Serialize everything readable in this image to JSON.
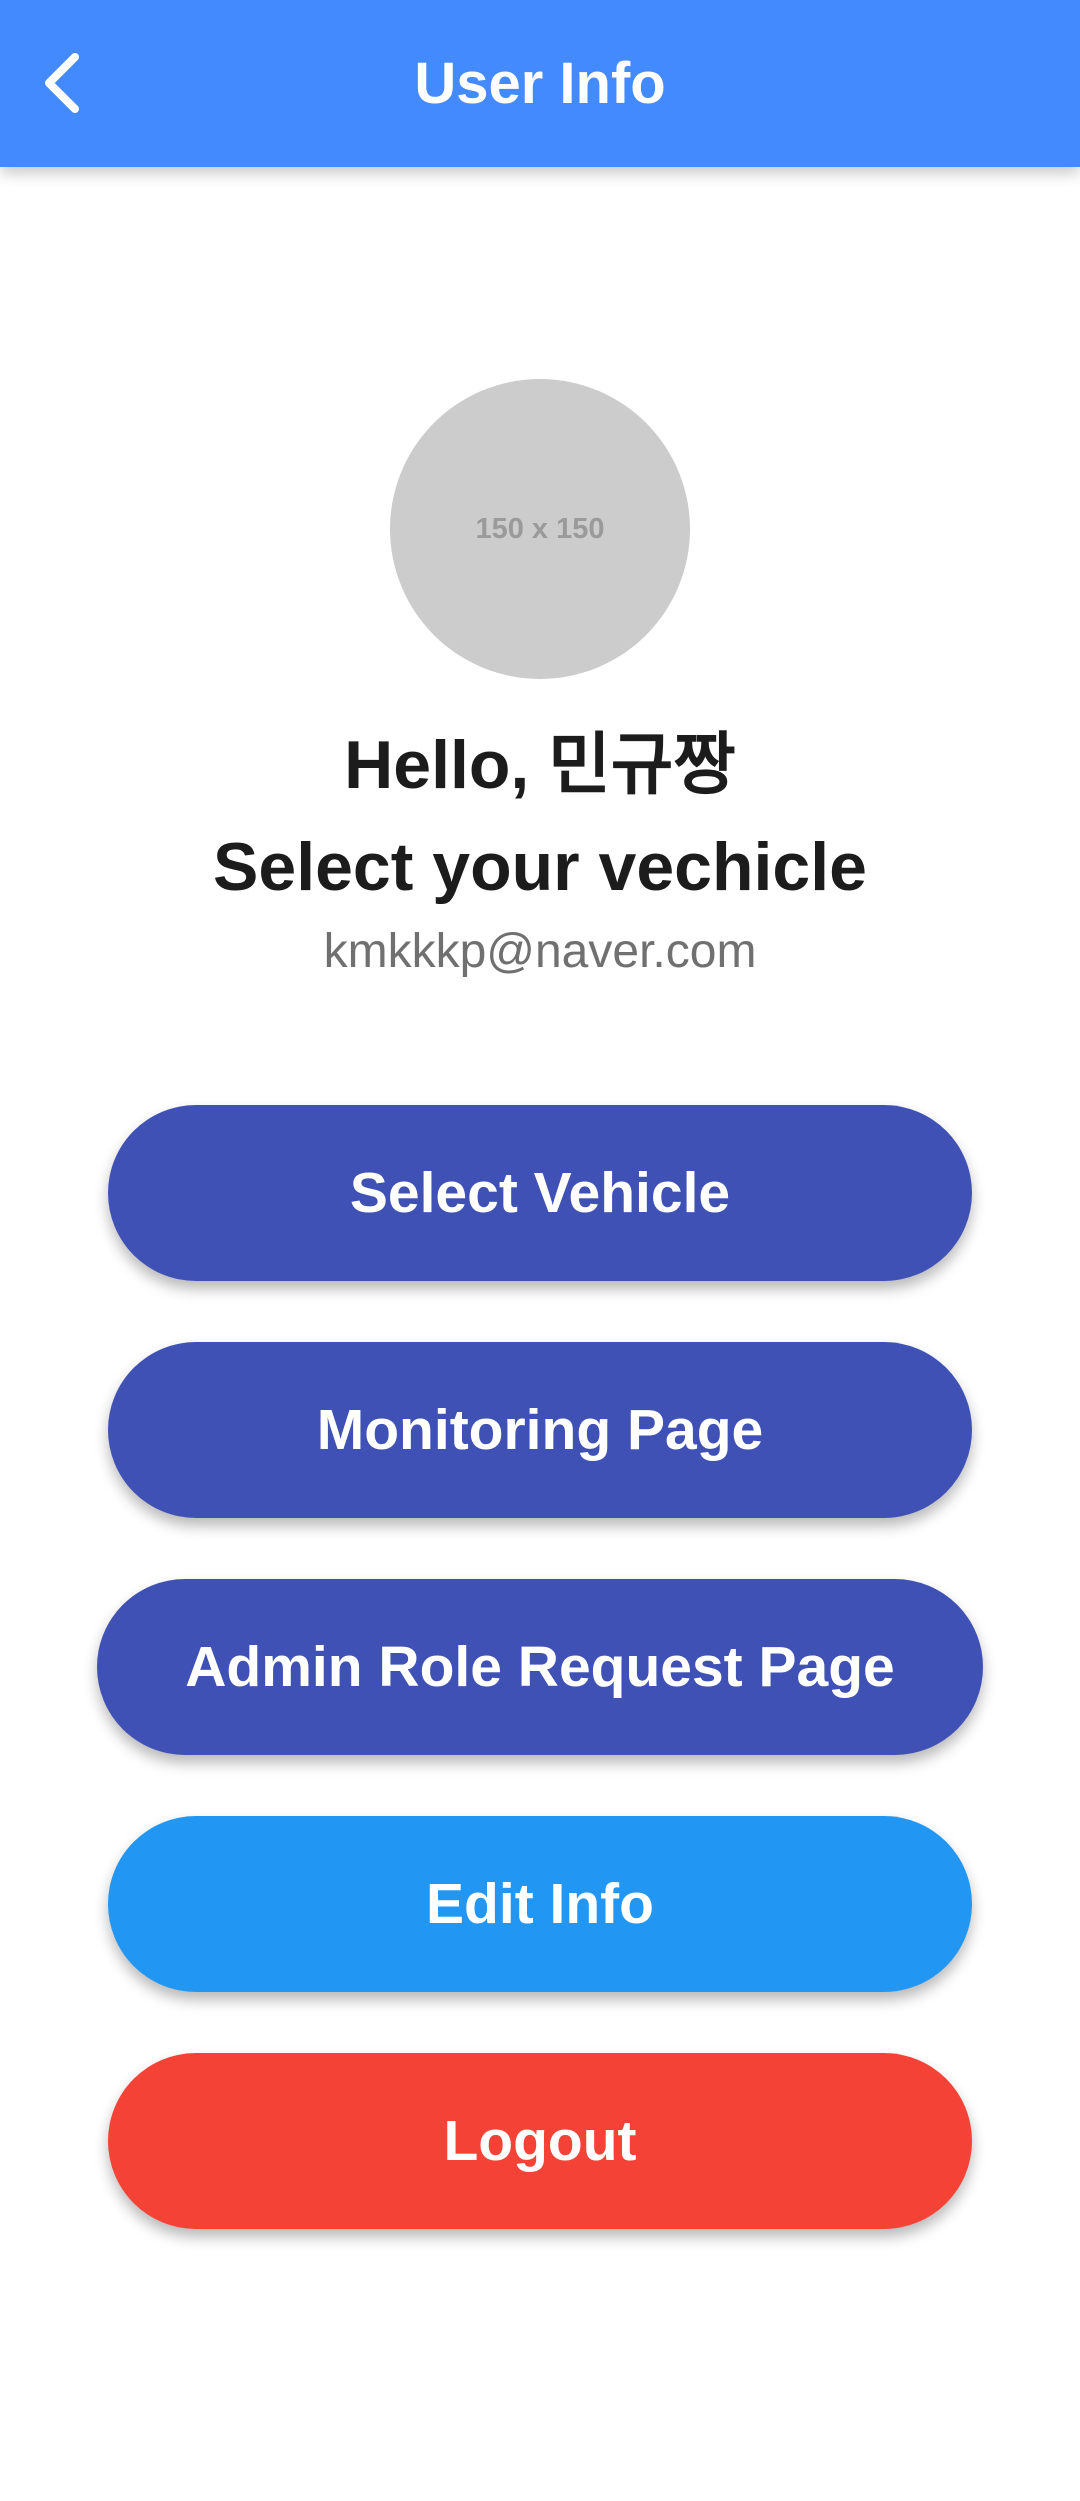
{
  "app_bar": {
    "title": "User Info",
    "back_icon": "chevron-left-icon",
    "color": "#448AFF"
  },
  "profile": {
    "avatar_placeholder": "150 x 150",
    "greeting": "Hello, 민규짱",
    "subtitle": "Select your vechicle",
    "email": "kmkkkp@naver.com"
  },
  "actions": {
    "select_vehicle": "Select Vehicle",
    "monitoring_page": "Monitoring Page",
    "admin_role_request": "Admin Role Request Page",
    "edit_info": "Edit Info",
    "logout": "Logout"
  },
  "colors": {
    "primary_button": "#3F51B5",
    "edit_button": "#2196F3",
    "logout_button": "#F44336"
  }
}
